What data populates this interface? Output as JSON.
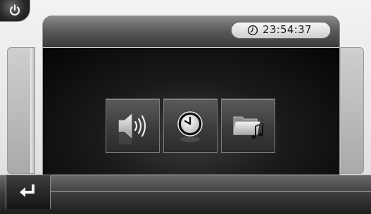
{
  "header": {
    "clock_time": "23:54:37",
    "clock_icon": "clock-outline-icon"
  },
  "buttons": {
    "power_icon": "power-icon",
    "back_icon": "return-arrow-icon"
  },
  "menu": {
    "tiles": [
      {
        "name": "volume",
        "icon": "speaker-volume-icon"
      },
      {
        "name": "time",
        "icon": "clock-icon"
      },
      {
        "name": "media",
        "icon": "music-folder-icon"
      }
    ]
  },
  "colors": {
    "background": "#e6e6e6",
    "panel_dark": "#0b0b0b",
    "tile": "#3c3c3c",
    "accent_white": "#f4f4f4"
  }
}
